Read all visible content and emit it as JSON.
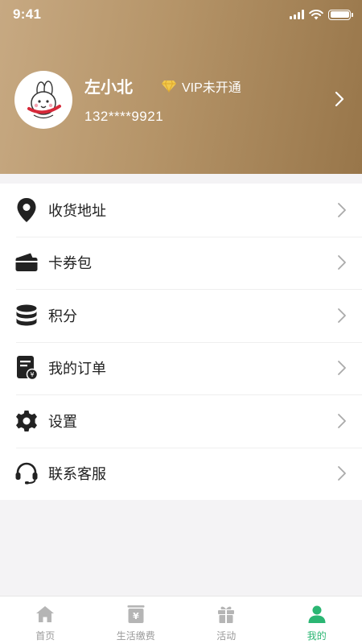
{
  "status_bar": {
    "time": "9:41"
  },
  "profile": {
    "name": "左小北",
    "vip_status": "VIP未开通",
    "phone": "132****9921",
    "avatar_tag": "左小北"
  },
  "menu": [
    {
      "label": "收货地址",
      "icon": "location-pin-icon"
    },
    {
      "label": "卡券包",
      "icon": "wallet-icon"
    },
    {
      "label": "积分",
      "icon": "coin-stack-icon"
    },
    {
      "label": "我的订单",
      "icon": "order-icon"
    },
    {
      "label": "设置",
      "icon": "gear-icon"
    },
    {
      "label": "联系客服",
      "icon": "headset-icon"
    }
  ],
  "tabbar": [
    {
      "label": "首页",
      "icon": "home-icon",
      "active": false
    },
    {
      "label": "生活缴费",
      "icon": "payment-icon",
      "active": false
    },
    {
      "label": "活动",
      "icon": "gift-icon",
      "active": false
    },
    {
      "label": "我的",
      "icon": "person-icon",
      "active": true
    }
  ],
  "colors": {
    "header_start": "#c7a982",
    "header_end": "#98764a",
    "active_tab": "#2bb673",
    "vip_gem": "#f2c94c"
  }
}
